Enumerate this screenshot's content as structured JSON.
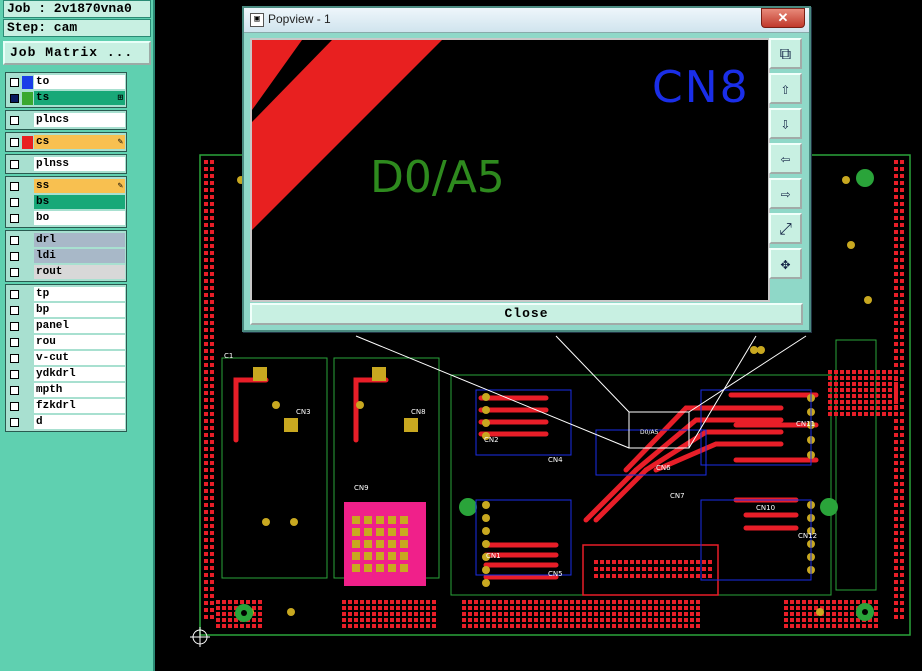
{
  "info": {
    "job_line": "Job : 2v1870vna0",
    "step_line": "Step: cam"
  },
  "job_matrix_button": "Job Matrix ...",
  "layer_groups": [
    [
      {
        "name": "to",
        "swatch": "#1a3ee8",
        "bg": "white",
        "checked": false
      },
      {
        "name": "ts",
        "swatch": "#3aa830",
        "bg": "ts-bg",
        "checked": true,
        "mark": "⊞"
      }
    ],
    [
      {
        "name": "plncs",
        "swatch": "",
        "bg": "white",
        "checked": false
      }
    ],
    [
      {
        "name": "cs",
        "swatch": "#e82020",
        "bg": "orange-bg",
        "checked": false,
        "mark": "✎"
      }
    ],
    [
      {
        "name": "plnss",
        "swatch": "",
        "bg": "white",
        "checked": false
      }
    ],
    [
      {
        "name": "ss",
        "swatch": "",
        "bg": "orange-bg",
        "checked": false,
        "mark": "✎"
      },
      {
        "name": "bs",
        "swatch": "",
        "bg": "green-bg",
        "checked": false
      },
      {
        "name": "bo",
        "swatch": "",
        "bg": "white",
        "checked": false
      }
    ],
    [
      {
        "name": "drl",
        "swatch": "",
        "bg": "gray-bg",
        "checked": false
      },
      {
        "name": "ldi",
        "swatch": "",
        "bg": "gray-bg",
        "checked": false
      },
      {
        "name": "rout",
        "swatch": "",
        "bg": "light-bg",
        "checked": false
      }
    ],
    [
      {
        "name": "tp",
        "swatch": "",
        "bg": "white",
        "checked": false
      },
      {
        "name": "bp",
        "swatch": "",
        "bg": "white",
        "checked": false
      },
      {
        "name": "panel",
        "swatch": "",
        "bg": "white",
        "checked": false
      },
      {
        "name": "rou",
        "swatch": "",
        "bg": "white",
        "checked": false
      },
      {
        "name": "v-cut",
        "swatch": "",
        "bg": "white",
        "checked": false
      },
      {
        "name": "ydkdrl",
        "swatch": "",
        "bg": "white",
        "checked": false
      },
      {
        "name": "mpth",
        "swatch": "",
        "bg": "white",
        "checked": false
      },
      {
        "name": "fzkdrl",
        "swatch": "",
        "bg": "white",
        "checked": false
      },
      {
        "name": "d",
        "swatch": "",
        "bg": "white",
        "checked": false
      }
    ]
  ],
  "popview": {
    "title": "Popview - 1",
    "close_x": "✕",
    "close_button": "Close",
    "canvas_labels": {
      "cn8": "CN8",
      "part": "D0/A5"
    },
    "tools": [
      "zoom-home-icon",
      "pan-up-icon",
      "pan-down-icon",
      "pan-left-icon",
      "pan-right-icon",
      "zoom-out-icon",
      "zoom-in-icon"
    ]
  },
  "pcb_labels": [
    "CN3",
    "CN4",
    "CN8",
    "CN2",
    "CN6",
    "CN7",
    "CN9",
    "CN10",
    "CN11",
    "CN12",
    "CN5",
    "CN1",
    "C1",
    "D0/A5"
  ],
  "colors": {
    "board_outline": "#2aa43a",
    "pad": "#e81e28",
    "pad_yellow": "#c8a820",
    "silk_blue": "#1a2ee8",
    "panel_bg": "#5fd0b0"
  }
}
